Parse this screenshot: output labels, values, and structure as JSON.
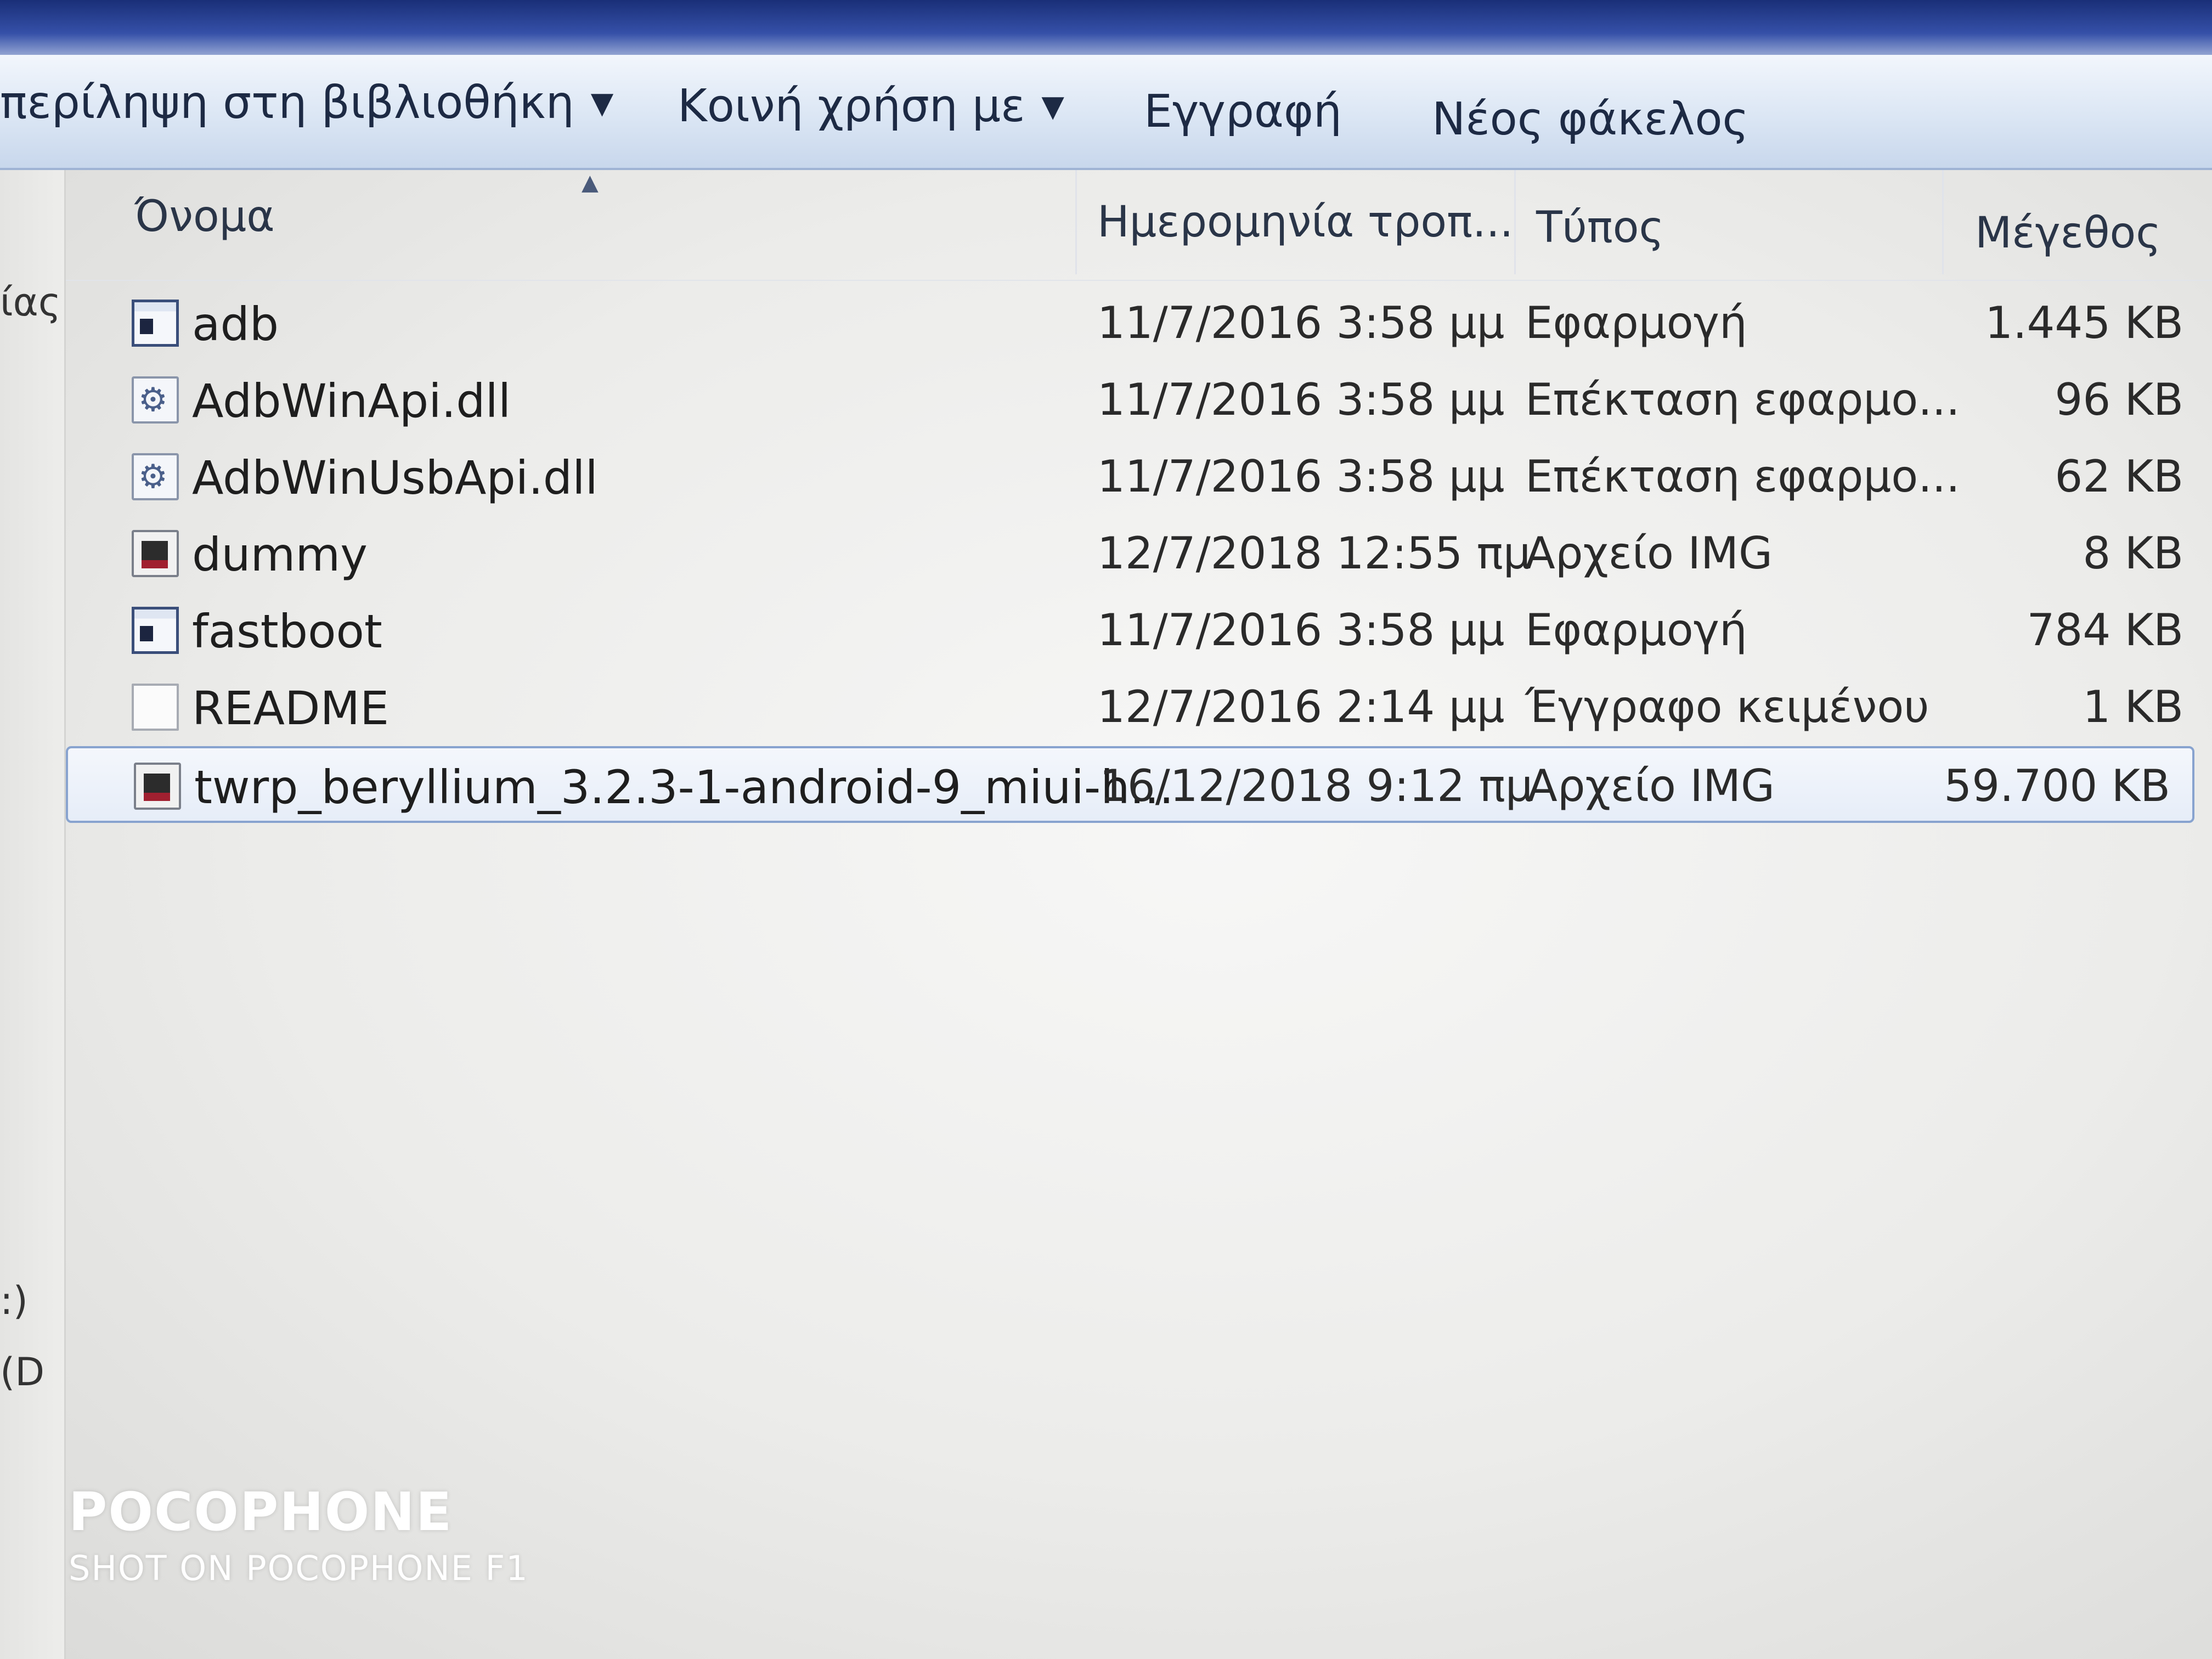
{
  "toolbar": {
    "include_in_library": "περίληψη στη βιβλιοθήκη",
    "share_with": "Κοινή χρήση με",
    "burn": "Εγγραφή",
    "new_folder": "Νέος φάκελος"
  },
  "left_pane": {
    "item_top": "ίας",
    "drive_c": ":)",
    "drive_d": "(D"
  },
  "columns": {
    "name": "Όνομα",
    "date_modified": "Ημερομηνία τροπ...",
    "type": "Τύπος",
    "size": "Μέγεθος"
  },
  "files": [
    {
      "name": "adb",
      "date": "11/7/2016 3:58 μμ",
      "type": "Εφαρμογή",
      "size": "1.445 KB",
      "icon": "application-icon"
    },
    {
      "name": "AdbWinApi.dll",
      "date": "11/7/2016 3:58 μμ",
      "type": "Επέκταση εφαρμο...",
      "size": "96 KB",
      "icon": "dll-file-icon"
    },
    {
      "name": "AdbWinUsbApi.dll",
      "date": "11/7/2016 3:58 μμ",
      "type": "Επέκταση εφαρμο...",
      "size": "62 KB",
      "icon": "dll-file-icon"
    },
    {
      "name": "dummy",
      "date": "12/7/2018 12:55 πμ",
      "type": "Αρχείο IMG",
      "size": "8 KB",
      "icon": "img-file-icon"
    },
    {
      "name": "fastboot",
      "date": "11/7/2016 3:58 μμ",
      "type": "Εφαρμογή",
      "size": "784 KB",
      "icon": "application-icon"
    },
    {
      "name": "README",
      "date": "12/7/2016 2:14 μμ",
      "type": "Έγγραφο κειμένου",
      "size": "1 KB",
      "icon": "text-file-icon"
    },
    {
      "name": "twrp_beryllium_3.2.3-1-android-9_miui-h...",
      "date": "16/12/2018 9:12 πμ",
      "type": "Αρχείο IMG",
      "size": "59.700 KB",
      "icon": "img-file-icon"
    }
  ],
  "watermark": {
    "brand": "POCOPHONE",
    "subtitle": "SHOT ON POCOPHONE F1"
  }
}
